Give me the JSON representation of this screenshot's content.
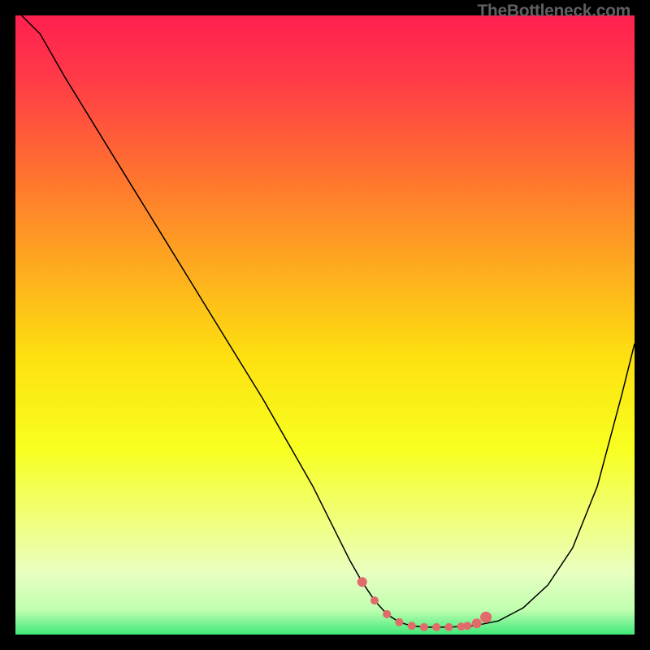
{
  "watermark": "TheBottleneck.com",
  "colors": {
    "curve": "#000000",
    "marker": "#E26A6A",
    "background_top": "#FF2050",
    "background_bottom": "#40E878"
  },
  "chart_data": {
    "type": "line",
    "title": "",
    "xlabel": "",
    "ylabel": "",
    "xlim": [
      0,
      100
    ],
    "ylim": [
      0,
      100
    ],
    "series": [
      {
        "name": "bottleneck-curve",
        "x": [
          0,
          4,
          8,
          12,
          16,
          20,
          24,
          28,
          32,
          36,
          40,
          44,
          48,
          50,
          52,
          54,
          56,
          58,
          60,
          62,
          64,
          66,
          70,
          74,
          78,
          82,
          86,
          90,
          94,
          98,
          100
        ],
        "y": [
          101,
          97,
          90,
          83.5,
          77,
          70.5,
          64,
          57.5,
          51,
          44.5,
          38,
          31,
          24,
          20,
          16,
          12,
          8.5,
          5.5,
          3.3,
          2,
          1.4,
          1.2,
          1.2,
          1.4,
          2.2,
          4.3,
          8,
          14,
          24,
          39,
          47
        ]
      }
    ],
    "markers": {
      "name": "optimal-zone",
      "color": "#E26A6A",
      "x": [
        56,
        58,
        60,
        62,
        64,
        66,
        68,
        70,
        72,
        73,
        74.5,
        76
      ],
      "y": [
        8.5,
        5.5,
        3.3,
        2.0,
        1.4,
        1.2,
        1.2,
        1.2,
        1.3,
        1.4,
        1.8,
        2.8
      ],
      "radius_px": [
        6,
        5,
        5,
        5,
        5,
        5,
        5,
        5,
        5,
        5,
        6,
        7
      ]
    },
    "ticks": {
      "x": [
        5,
        18,
        31,
        44,
        57,
        70,
        83,
        96
      ],
      "y": [
        8,
        22,
        36,
        50,
        64,
        78,
        92
      ]
    }
  }
}
